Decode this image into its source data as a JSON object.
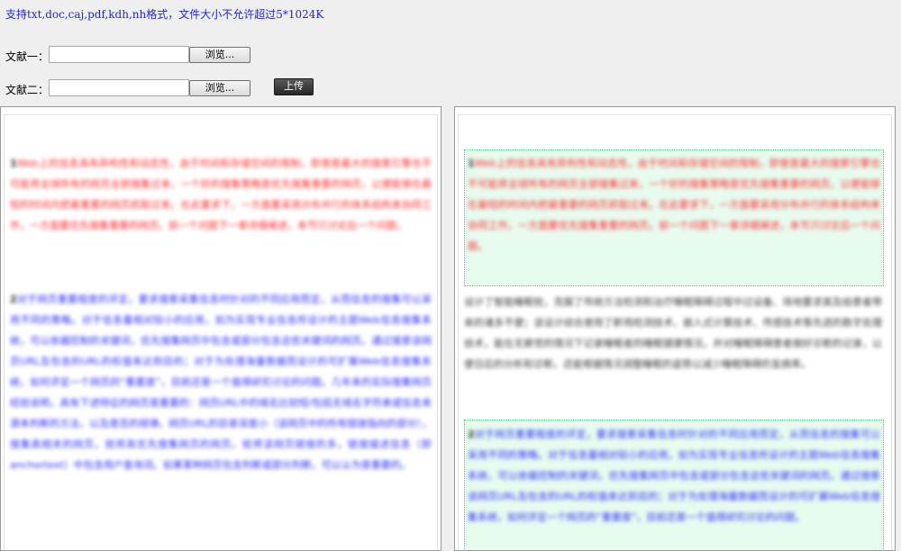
{
  "hint": "支持txt,doc,caj,pdf,kdh,nh格式，文件大小不允许超过5*1024K",
  "doc1": {
    "label": "文献一：",
    "value": "",
    "browse": "浏览..."
  },
  "doc2": {
    "label": "文献二：",
    "value": "",
    "browse": "浏览..."
  },
  "upload": "上传",
  "left_panel": {
    "p1_num": "1",
    "p1": "Web上的信息具有异构性和动态性，由于时间和存储空间的限制，即使是最大的搜索引擎也不可能将全球所有的网页全部搜集过来，一个好的搜集策略是优先搜集重要的网页，以便能够在最短的时间内把最重要的网页抓取过来。在此要求下，一方面要采用分布并行的体系结构来协同工作，一方面要优先搜集重要的网页。前一个问题下一章详细阐述，本节只讨论后一个问题。",
    "p2_num": "2",
    "p2": "对于网页重要程度的评定，要求搜索采集信息时针对的不同应用而定，从而信息的搜集可以采用不同的策略。对于信息量相对较小的应用，如为实现专业信息所设计的主题Web信息搜集系统，可以依据控制的关键词，优先搜集网页中包含或部分包含这些关键词的网页。通过搜索该网页URL及包含的URL的权值来达到目的；对于为处理海量数据而设计的可扩展Web信息搜集系统，如何评定一个网页的“重要度”，目前还是一个值得研究讨论的问题。几年来的实际搜集网页经验说明，具有下述特征的网页是重要的：网页URL中的域名比较短/包括无域名字符串或信息来源本判断的方法，以及是否的规律。网页URL的目录深度小（该网页中的所有链接指向的部分），搜集高相关的网页，就将其优先搜集网页的网页。就将该网页链接的多，链接描述信息（即anchortext）中包含用户查询词。如果某种网页包含判断或部分判断，可以认为是重要的。"
  },
  "right_panel": {
    "p1_num": "1",
    "p1": "Web上的信息具有异构性和动态性，由于时间和存储空间的限制，即使是最大的搜索引擎也不可能将全球所有的网页全部搜集过来，一个好的搜集策略是优先搜集重要的网页，以便能够在最短的时间内把最重要的网页抓取过来。在此要求下，一方面要采用分布并行的体系结构来协同工作，一方面要优先搜集重要的网页。前一个问题下一章详细阐述，本节只讨论后一个问题。",
    "p_mid": "设计了智能睡眠枕，克服了传统方法检测和治疗睡眠障碍过程中过设备、场地要求高及给患者带来的诸多不便；该设计综合使用了鼾用检测技术、嵌入式计算技术、传感技术等先进的数字处理技术，能在无察觉的情况下记录睡眠者的睡眠健康情况，并对睡眠障碍患者做好诊断的记录，以便日后的分析和诊断，还能根据情况调整睡眠的姿势以减少睡眠障碍的发病率。",
    "p2_num": "2",
    "p2": "对于网页重要程度的评定，要求搜索采集信息时针对的不同应用而定，从而信息的搜集可以采用不同的策略。对于信息量相对较小的应用，如为实现专业信息所设计的主题Web信息搜集系统，可以依据控制的关键词，优先搜集网页中包含或部分包含这些关键词的网页。通过搜索该网页URL及包含的URL的权值来达到目的；对于为处理海量数据而设计的可扩展Web信息搜集系统，如何评定一个网页的“重要度”，目前还是一个值得研究讨论的问题。"
  }
}
